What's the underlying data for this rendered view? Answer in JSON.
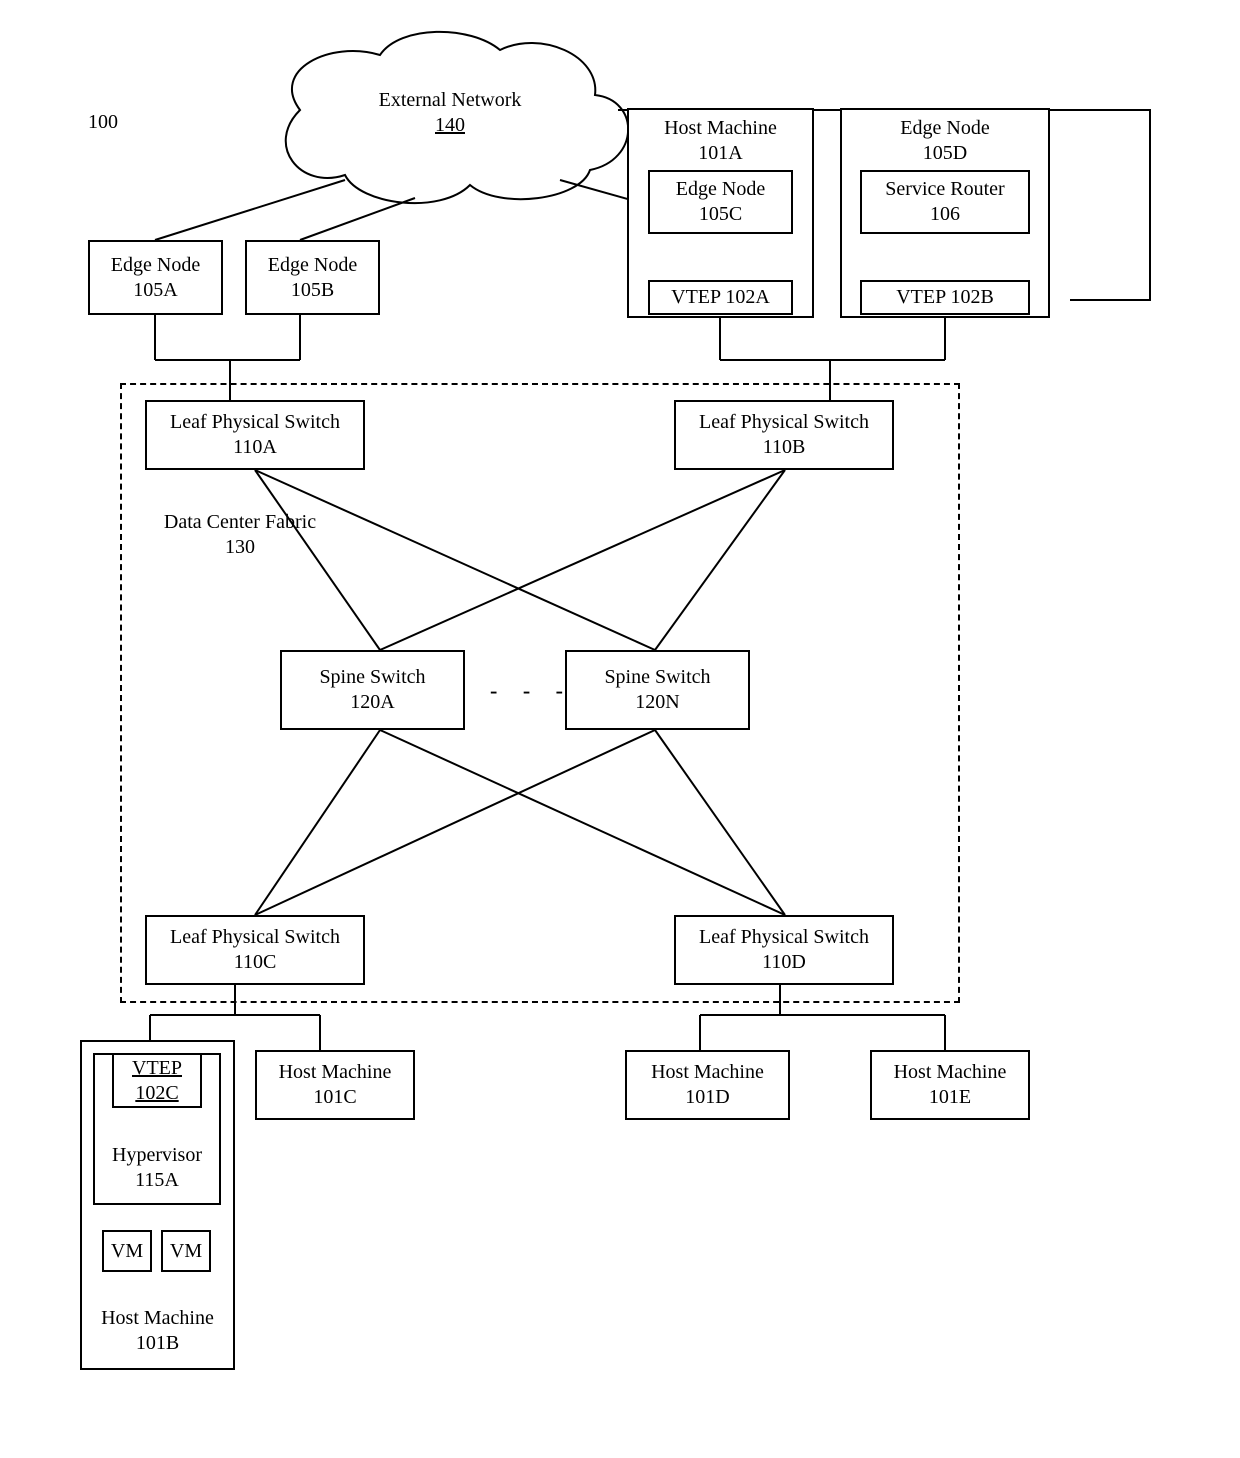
{
  "figure_number": "100",
  "cloud": {
    "title": "External Network",
    "id": "140"
  },
  "edge_nodes": {
    "a": {
      "title": "Edge Node",
      "id": "105A"
    },
    "b": {
      "title": "Edge Node",
      "id": "105B"
    },
    "c": {
      "title": "Edge Node",
      "id": "105C"
    },
    "d": {
      "title": "Edge Node",
      "id": "105D"
    }
  },
  "host_machines": {
    "a": {
      "title": "Host Machine",
      "id": "101A"
    },
    "b": {
      "title": "Host Machine",
      "id": "101B"
    },
    "c": {
      "title": "Host Machine",
      "id": "101C"
    },
    "d": {
      "title": "Host  Machine",
      "id": "101D"
    },
    "e": {
      "title": "Host Machine",
      "id": "101E"
    }
  },
  "service_router": {
    "title": "Service Router",
    "id": "106"
  },
  "vteps": {
    "a": "VTEP 102A",
    "b": "VTEP 102B",
    "c_title": "VTEP",
    "c_id": "102C"
  },
  "fabric": {
    "title": "Data Center Fabric",
    "id": "130"
  },
  "leaf_switches": {
    "a": {
      "title": "Leaf Physical Switch",
      "id": "110A"
    },
    "b": {
      "title": "Leaf Physical Switch",
      "id": "110B"
    },
    "c": {
      "title": "Leaf Physical Switch",
      "id": "110C"
    },
    "d": {
      "title": "Leaf Physical Switch",
      "id": "110D"
    }
  },
  "spine_switches": {
    "a": {
      "title": "Spine Switch",
      "id": "120A"
    },
    "n": {
      "title": "Spine Switch",
      "id": "120N"
    }
  },
  "hypervisor": {
    "title": "Hypervisor",
    "id": "115A"
  },
  "vm_label": "VM",
  "ellipsis": "- - -"
}
